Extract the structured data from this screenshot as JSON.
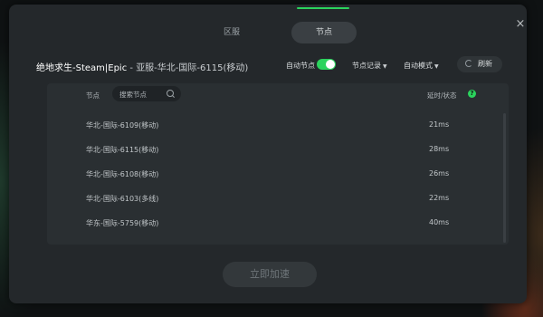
{
  "tabs": [
    {
      "label": "区服"
    },
    {
      "label": "节点"
    }
  ],
  "close_glyph": "×",
  "game": {
    "title": "绝地求生-Steam|Epic",
    "separator": " - ",
    "current_node": "亚服-华北-国际-6115(移动)"
  },
  "controls": {
    "auto_node_label": "自动节点",
    "auto_node_on": true,
    "node_history_label": "节点记录",
    "auto_mode_label": "自动模式",
    "refresh_label": "刷新"
  },
  "table": {
    "col_node": "节点",
    "search_placeholder": "搜索节点",
    "col_latency": "延时/状态",
    "rows": [
      {
        "name": "华北-国际-6109(移动)",
        "latency": "21ms"
      },
      {
        "name": "华北-国际-6115(移动)",
        "latency": "28ms"
      },
      {
        "name": "华北-国际-6108(移动)",
        "latency": "26ms"
      },
      {
        "name": "华北-国际-6103(多线)",
        "latency": "22ms"
      },
      {
        "name": "华东-国际-5759(移动)",
        "latency": "40ms"
      }
    ]
  },
  "accelerate_label": "立即加速",
  "colors": {
    "accent": "#2bd35d",
    "panel": "#24282b",
    "table_bg": "#2a2f32"
  },
  "icons": [
    "close-icon",
    "search-icon",
    "help-icon",
    "refresh-icon",
    "caret-down-icon"
  ]
}
